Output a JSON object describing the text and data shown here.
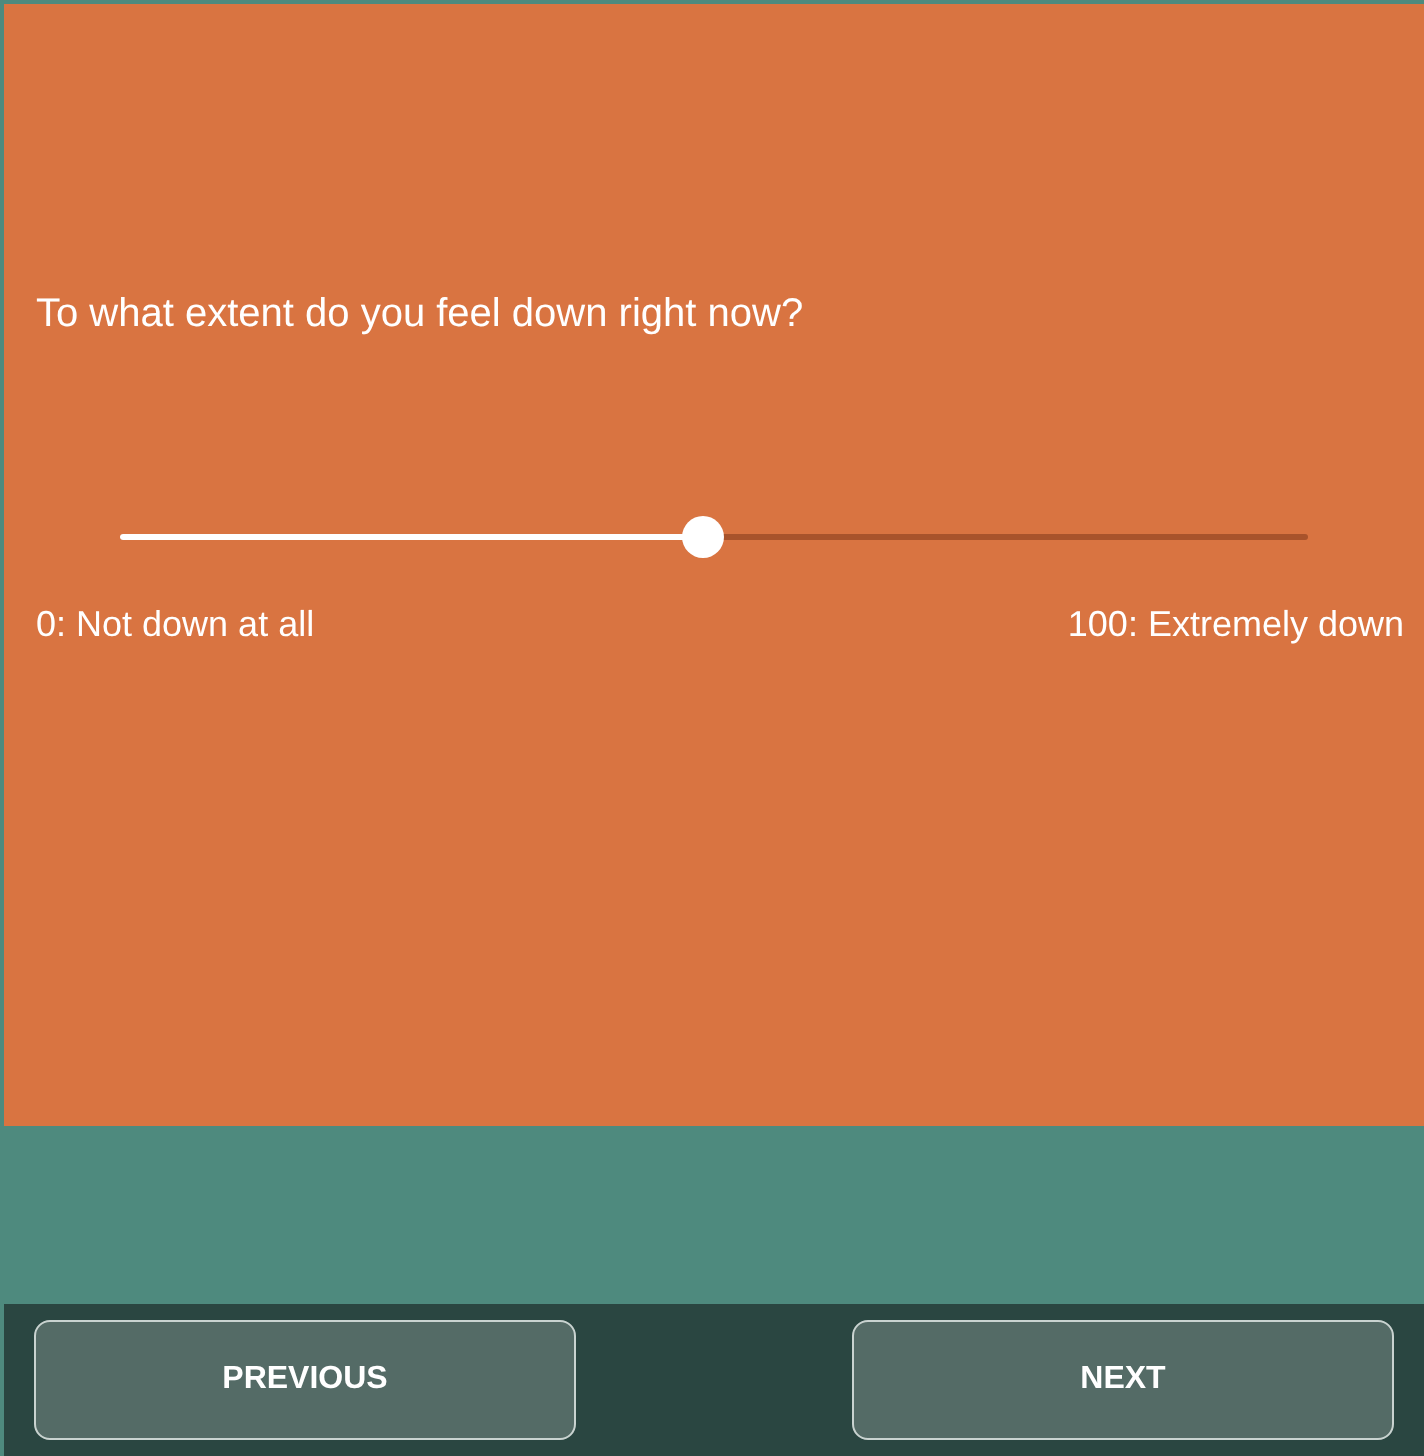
{
  "question": "To what extent do you feel down right now?",
  "slider": {
    "level": 0.49,
    "min_label": "0: Not down at all",
    "max_label": "100: Extremely down"
  },
  "buttons": [
    {
      "label": "PREVIOUS"
    },
    {
      "label": "NEXT"
    }
  ]
}
